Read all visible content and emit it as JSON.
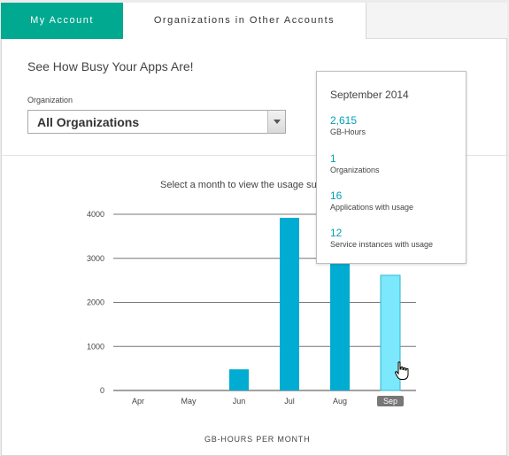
{
  "tabs": [
    {
      "label": "My Account",
      "active": true
    },
    {
      "label": "Organizations in Other Accounts",
      "active": false
    }
  ],
  "header": {
    "title": "See How Busy Your Apps Are!"
  },
  "organization": {
    "label": "Organization",
    "selected": "All Organizations"
  },
  "instruction": "Select a month to view the usage su",
  "chart_caption": "GB-HOURS PER MONTH",
  "tooltip": {
    "title": "September 2014",
    "stats": [
      {
        "value": "2,615",
        "label": "GB-Hours"
      },
      {
        "value": "1",
        "label": "Organizations"
      },
      {
        "value": "16",
        "label": "Applications with usage"
      },
      {
        "value": "12",
        "label": "Service instances with usage"
      }
    ]
  },
  "colors": {
    "accent": "#00a98f",
    "bar": "#00acd1",
    "bar_selected": "#7ce8fb",
    "link": "#00a0b4"
  },
  "chart_data": {
    "type": "bar",
    "categories": [
      "Apr",
      "May",
      "Jun",
      "Jul",
      "Aug",
      "Sep"
    ],
    "values": [
      0,
      0,
      480,
      3920,
      2900,
      2615
    ],
    "selected": "Sep",
    "xlabel": "GB-HOURS PER MONTH",
    "ylabel": "",
    "ylim": [
      0,
      4000
    ],
    "yticks": [
      0,
      1000,
      2000,
      3000,
      4000
    ],
    "grid": true
  }
}
